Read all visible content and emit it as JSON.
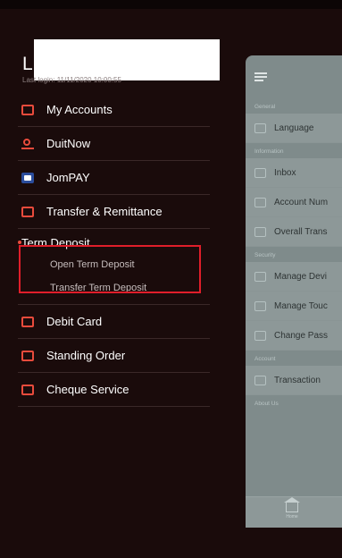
{
  "user": {
    "initial": "L",
    "last_login": "Last login: 11/11/2020 10:00:55"
  },
  "menu": {
    "my_accounts": "My Accounts",
    "duitnow": "DuitNow",
    "jompay": "JomPAY",
    "transfer": "Transfer & Remittance",
    "term_deposit": "Term Deposit",
    "open_term_deposit": "Open Term Deposit",
    "transfer_term_deposit": "Transfer Term Deposit",
    "debit_card": "Debit Card",
    "standing_order": "Standing Order",
    "cheque_service": "Cheque Service"
  },
  "background_page": {
    "sections": {
      "general": "General",
      "information": "Information",
      "security": "Security",
      "account": "Account",
      "about": "About Us"
    },
    "rows": {
      "language": "Language",
      "inbox": "Inbox",
      "account_number": "Account Num",
      "overall": "Overall Trans",
      "manage_device": "Manage Devi",
      "manage_touch": "Manage Touc",
      "change_password": "Change Pass",
      "transaction": "Transaction"
    },
    "home_label": "Home"
  },
  "colors": {
    "accent": "#e94b3c",
    "highlight": "#e01e2a",
    "drawer_bg": "#1a0b0b"
  }
}
